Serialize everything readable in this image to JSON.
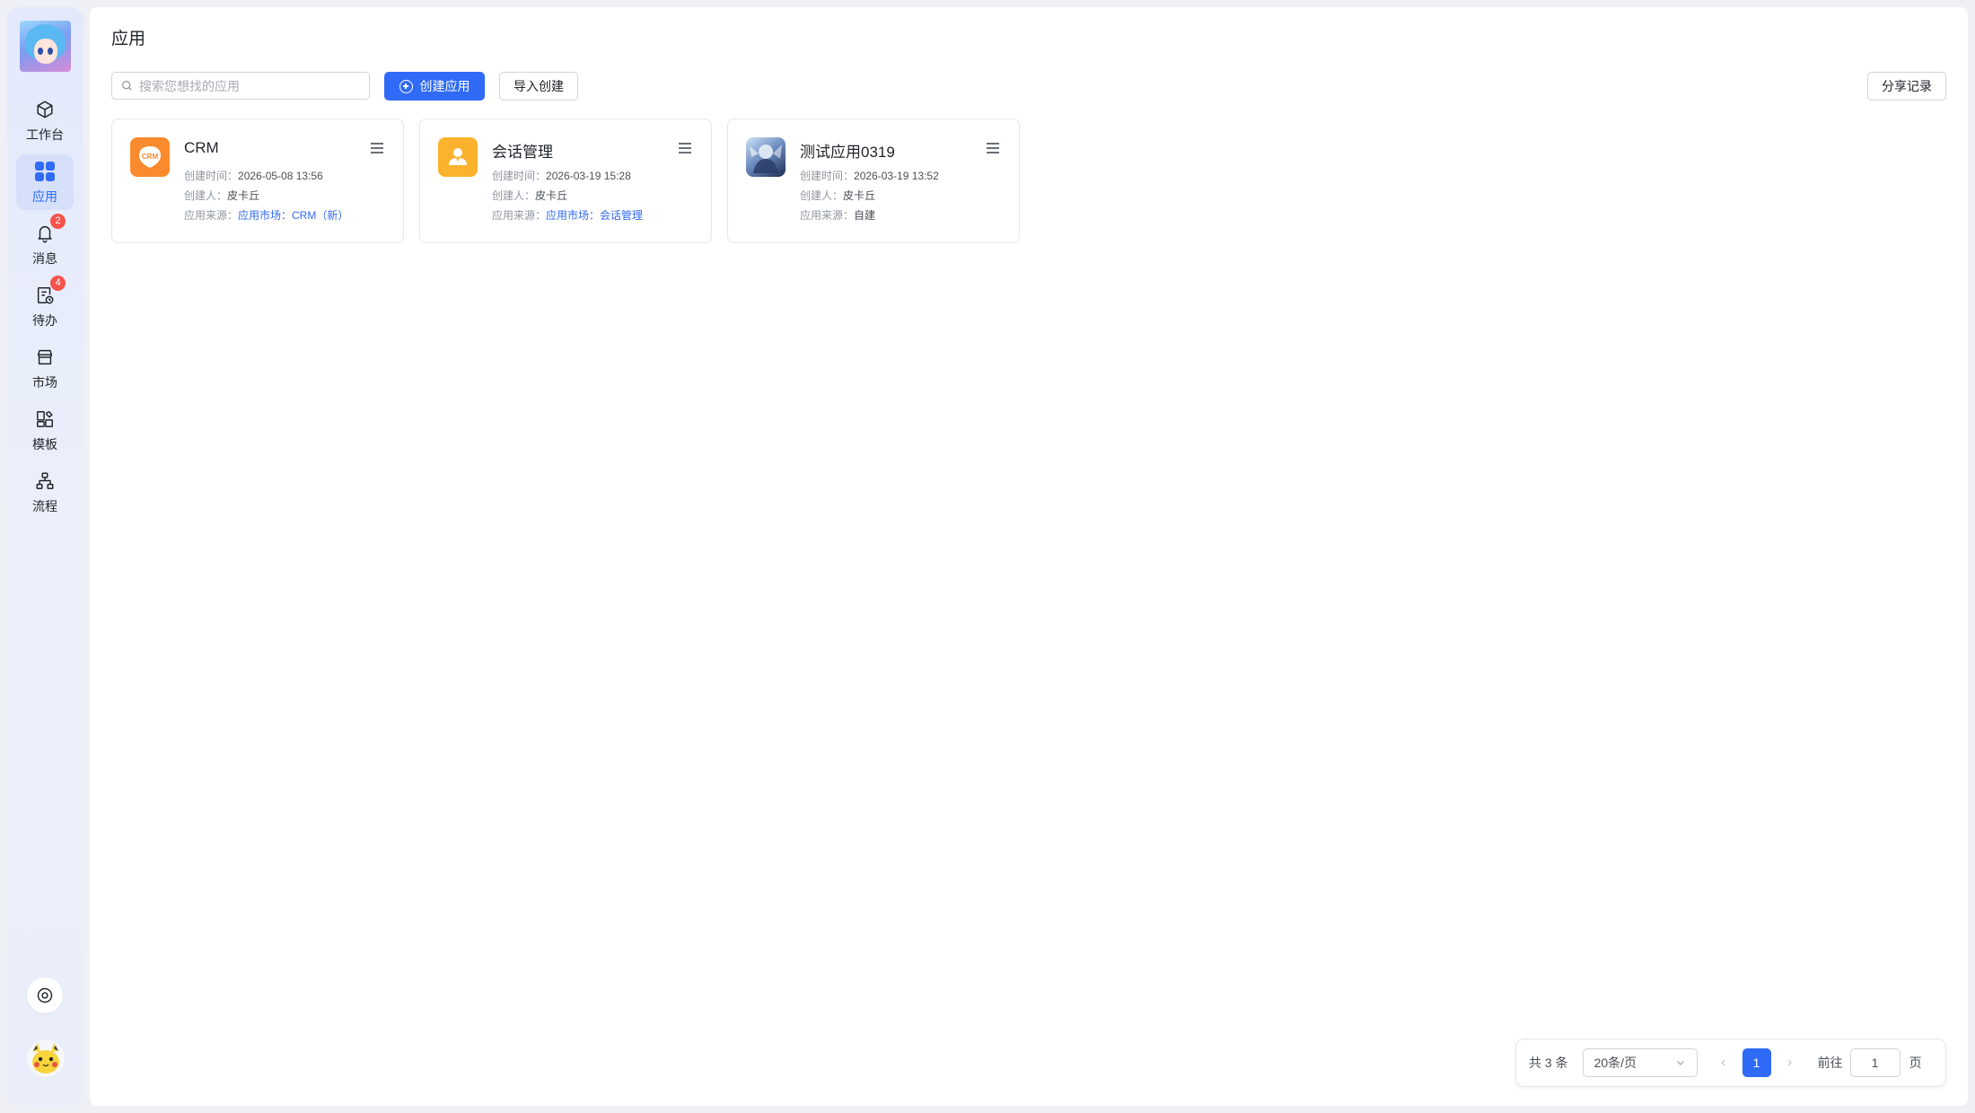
{
  "sidebar": {
    "items": [
      {
        "label": "工作台",
        "icon": "cube-icon"
      },
      {
        "label": "应用",
        "icon": "apps-grid-icon",
        "active": true
      },
      {
        "label": "消息",
        "icon": "bell-icon",
        "badge": "2"
      },
      {
        "label": "待办",
        "icon": "todo-clock-icon",
        "badge": "4"
      },
      {
        "label": "市场",
        "icon": "store-icon"
      },
      {
        "label": "模板",
        "icon": "template-icon"
      },
      {
        "label": "流程",
        "icon": "flow-icon"
      }
    ]
  },
  "header": {
    "title": "应用"
  },
  "toolbar": {
    "search_placeholder": "搜索您想找的应用",
    "create_label": "创建应用",
    "import_label": "导入创建",
    "share_label": "分享记录"
  },
  "cards": [
    {
      "name": "CRM",
      "icon_text": "CRM",
      "icon_color": "#f98a2d",
      "created_time_label": "创建时间：",
      "created_time": "2026-05-08 13:56",
      "creator_label": "创建人：",
      "creator": "皮卡丘",
      "source_label": "应用来源：",
      "source": "应用市场：CRM（新）"
    },
    {
      "name": "会话管理",
      "icon_color": "#fbb22c",
      "created_time_label": "创建时间：",
      "created_time": "2026-03-19 15:28",
      "creator_label": "创建人：",
      "creator": "皮卡丘",
      "source_label": "应用来源：",
      "source": "应用市场：会话管理"
    },
    {
      "name": "测试应用0319",
      "created_time_label": "创建时间：",
      "created_time": "2026-03-19 13:52",
      "creator_label": "创建人：",
      "creator": "皮卡丘",
      "source_label": "应用来源：",
      "source": "自建"
    }
  ],
  "pagination": {
    "total": "共 3 条",
    "page_size": "20条/页",
    "current_page": "1",
    "goto_label": "前往",
    "goto_value": "1",
    "page_unit": "页"
  },
  "colors": {
    "accent": "#2f6bf6",
    "badge": "#f5544c"
  }
}
